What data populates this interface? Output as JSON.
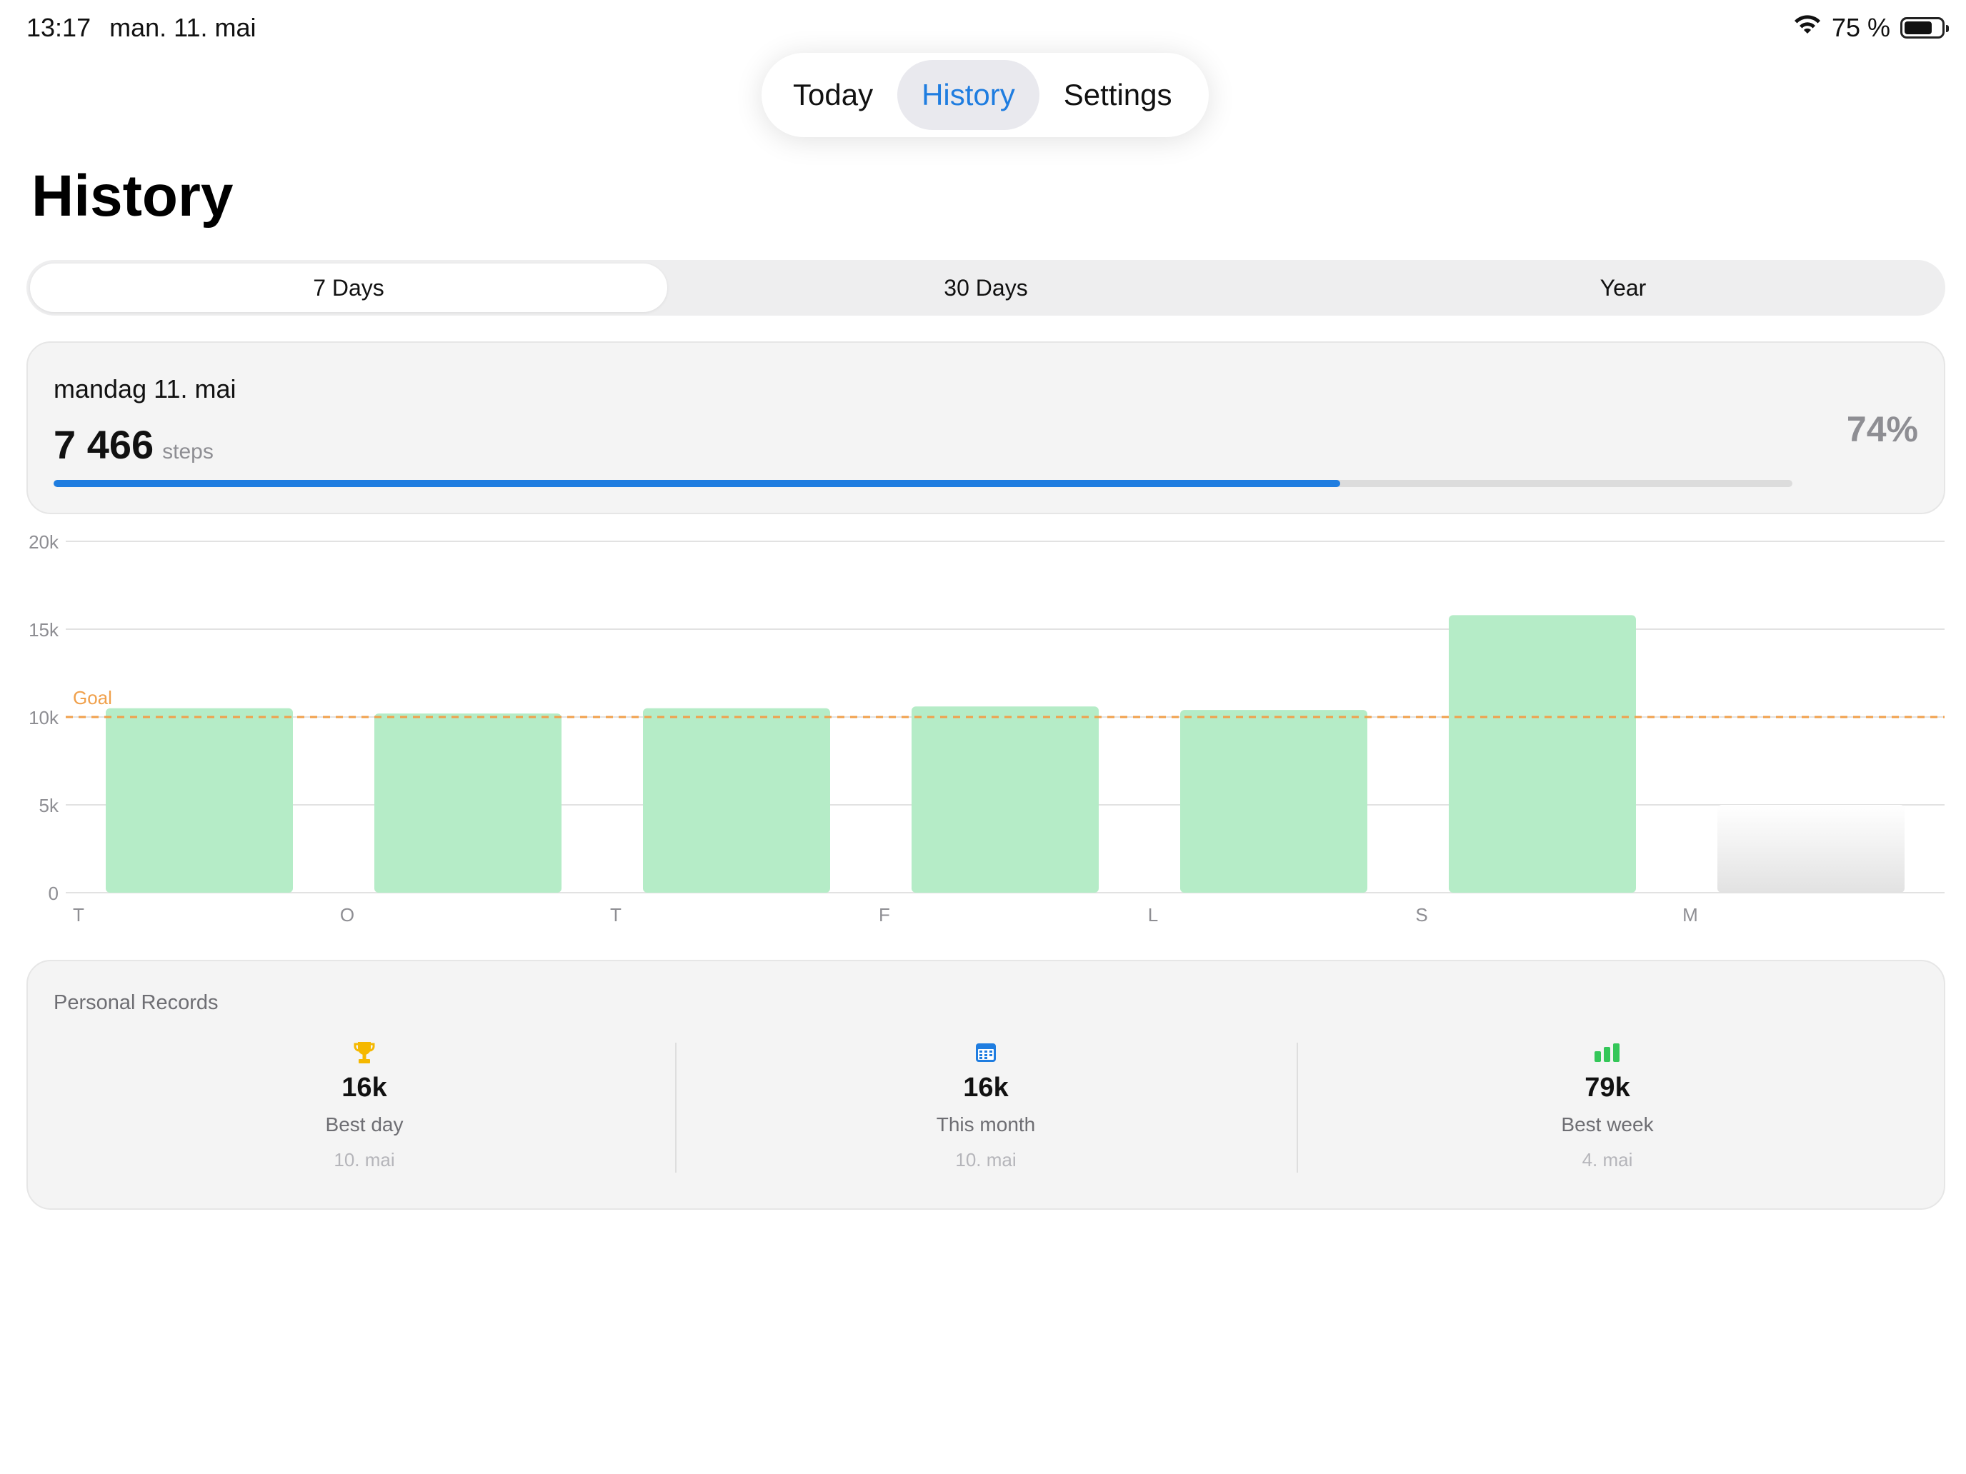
{
  "status": {
    "time": "13:17",
    "date": "man. 11. mai",
    "battery": "75 %"
  },
  "tabs": [
    {
      "label": "Today",
      "active": false
    },
    {
      "label": "History",
      "active": true
    },
    {
      "label": "Settings",
      "active": false
    }
  ],
  "page_title": "History",
  "range": {
    "options": [
      "7 Days",
      "30 Days",
      "Year"
    ],
    "selected": "7 Days"
  },
  "summary": {
    "date": "mandag 11. mai",
    "steps": "7 466",
    "unit": "steps",
    "percent": "74%",
    "progress": 0.74
  },
  "chart_data": {
    "type": "bar",
    "categories": [
      "T",
      "O",
      "T",
      "F",
      "L",
      "S",
      "M"
    ],
    "values": [
      10500,
      10200,
      10500,
      10600,
      10400,
      15800,
      5000
    ],
    "ylim": [
      0,
      20000
    ],
    "yticks": [
      "0",
      "5k",
      "10k",
      "15k",
      "20k"
    ],
    "goal": 10000,
    "goal_label": "Goal",
    "colors": {
      "bar": "#b5ecc7",
      "current_bar": "#e6e6e6",
      "goal": "#f0a04b",
      "grid": "#e2e2e2"
    }
  },
  "records": {
    "title": "Personal Records",
    "items": [
      {
        "icon": "trophy-icon",
        "value": "16k",
        "label": "Best day",
        "date": "10. mai",
        "color": "#f5b800"
      },
      {
        "icon": "calendar-icon",
        "value": "16k",
        "label": "This month",
        "date": "10. mai",
        "color": "#1f7de0"
      },
      {
        "icon": "bar-chart-icon",
        "value": "79k",
        "label": "Best week",
        "date": "4. mai",
        "color": "#34c759"
      }
    ]
  }
}
